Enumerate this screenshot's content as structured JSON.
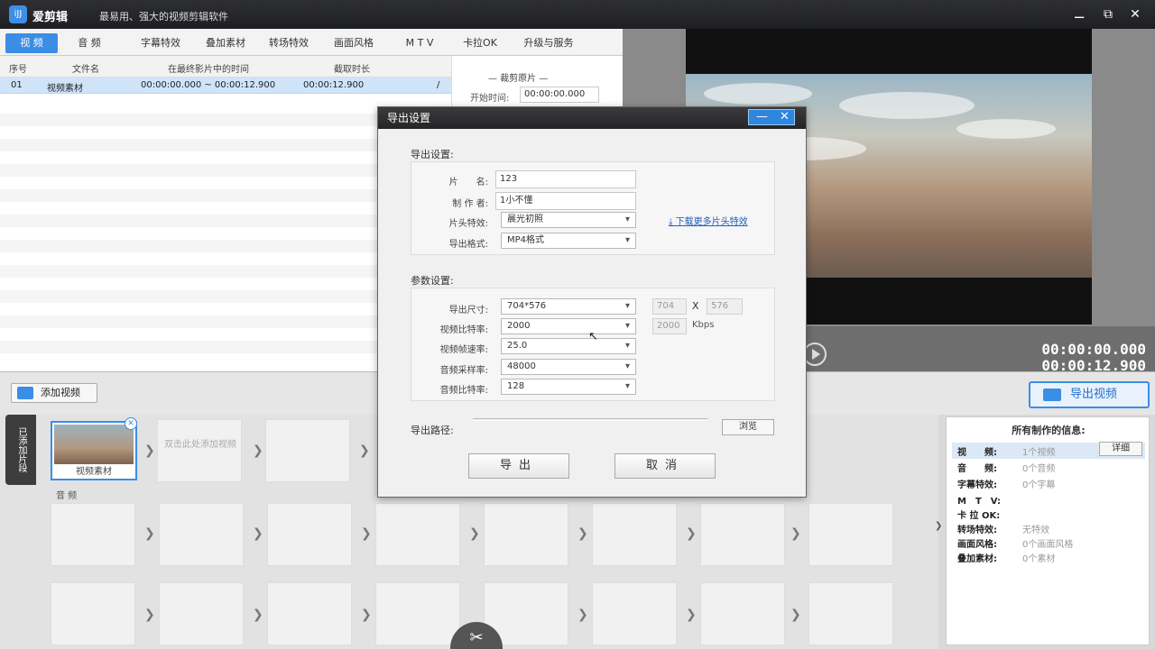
{
  "app": {
    "name": "爱剪辑",
    "logo_text": "iJJ",
    "slogan": "最易用、强大的视频剪辑软件",
    "window_buttons": [
      "⚊",
      "⧉",
      "✕"
    ]
  },
  "menu": {
    "tabs": [
      {
        "label": "视 频",
        "active": true
      },
      {
        "label": "音 频",
        "active": false
      },
      {
        "label": "字幕特效",
        "active": false
      },
      {
        "label": "叠加素材",
        "active": false
      },
      {
        "label": "转场特效",
        "active": false
      },
      {
        "label": "画面风格",
        "active": false
      },
      {
        "label": "M T V",
        "active": false
      },
      {
        "label": "卡拉OK",
        "active": false
      },
      {
        "label": "升级与服务",
        "active": false
      }
    ]
  },
  "clip_table": {
    "headers": [
      "序号",
      "文件名",
      "在最终影片中的时间",
      "截取时长"
    ],
    "rows": [
      {
        "index": "01",
        "name": "视频素材",
        "range": "00:00:00.000 ~ 00:00:12.900",
        "duration": "00:00:12.900"
      }
    ]
  },
  "trim": {
    "caption": "— 裁剪原片 —",
    "start_label": "开始时间:",
    "start_value": "00:00:00.000"
  },
  "preview": {
    "current_time": "00:00:00.000",
    "total_time": "00:00:12.900"
  },
  "toolbar": {
    "add_video": "添加视频",
    "export_video": "导出视频"
  },
  "timeline": {
    "side_tab": "已添加片段",
    "clip_label": "视频素材",
    "hint": "双击此处添加视频",
    "audio_label": "音 频"
  },
  "info_panel": {
    "title": "所有制作的信息:",
    "detail_button": "详细",
    "rows": [
      {
        "key": "视　　频:",
        "value": "1个视频"
      },
      {
        "key": "音　　频:",
        "value": "0个音频"
      },
      {
        "key": "字幕特效:",
        "value": "0个字幕"
      },
      {
        "key": "M　T　V:",
        "value": ""
      },
      {
        "key": "卡 拉 OK:",
        "value": ""
      },
      {
        "key": "转场特效:",
        "value": "无特效"
      },
      {
        "key": "画面风格:",
        "value": "0个画面风格"
      },
      {
        "key": "叠加素材:",
        "value": "0个素材"
      }
    ]
  },
  "dialog": {
    "title": "导出设置",
    "group1_title": "导出设置:",
    "group2_title": "参数设置:",
    "fields": {
      "film_name_label": "片　　名:",
      "film_name_value": "123",
      "author_label": "制 作 者:",
      "author_value": "1小不懂",
      "intro_label": "片头特效:",
      "intro_value": "晨光初照",
      "format_label": "导出格式:",
      "format_value": "MP4格式",
      "download_link": "下载更多片头特效",
      "size_label": "导出尺寸:",
      "size_value": "704*576",
      "width_value": "704",
      "x_sep": "X",
      "height_value": "576",
      "vbitrate_label": "视频比特率:",
      "vbitrate_value": "2000",
      "vbitrate_custom": "2000",
      "vbitrate_unit": "Kbps",
      "fps_label": "视频帧速率:",
      "fps_value": "25.0",
      "asample_label": "音频采样率:",
      "asample_value": "48000",
      "abitrate_label": "音频比特率:",
      "abitrate_value": "128",
      "path_label": "导出路径:",
      "browse": "浏览"
    },
    "export_button": "导出",
    "cancel_button": "取消"
  }
}
